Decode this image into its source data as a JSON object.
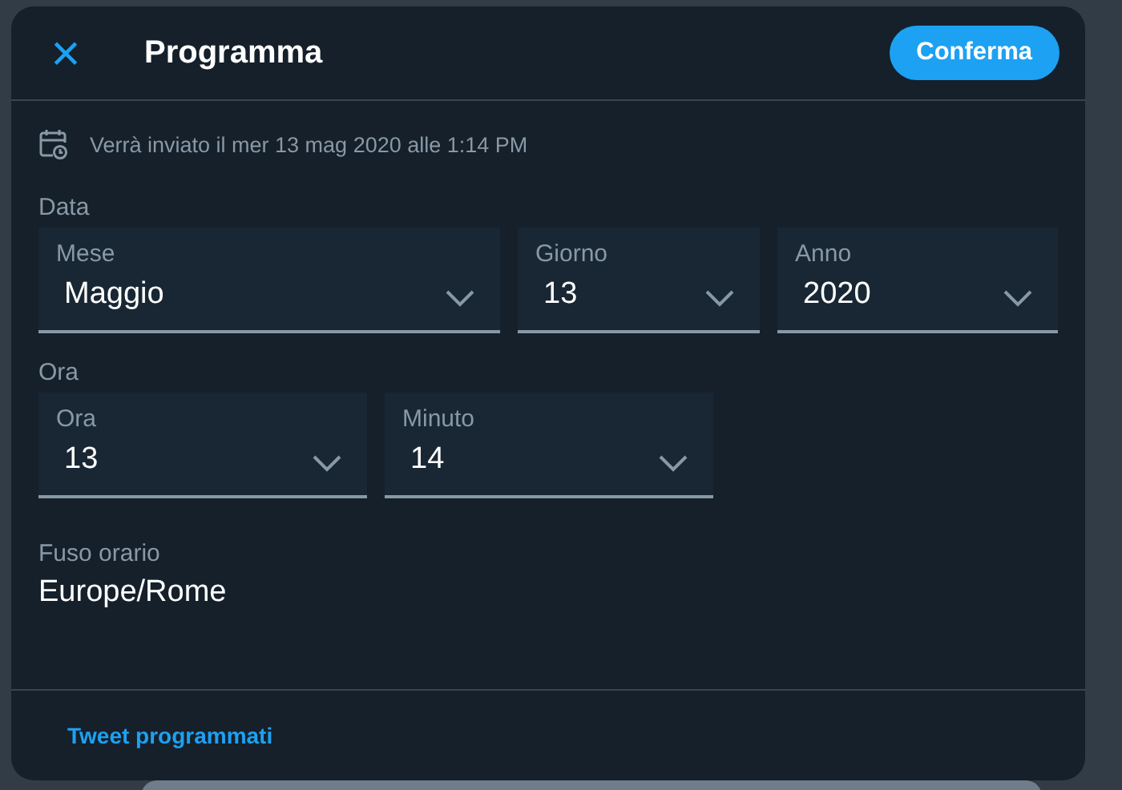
{
  "dialog": {
    "title": "Programma",
    "close_icon": "×",
    "confirm_button": "Conferma"
  },
  "notice": "Verrà inviato il mer 13 mag 2020 alle 1:14 PM",
  "sections": [
    {
      "label": "Data",
      "fields": [
        {
          "label": "Mese",
          "value": "Maggio",
          "kind": "select"
        },
        {
          "label": "Giorno",
          "value": "13",
          "kind": "select"
        },
        {
          "label": "Anno",
          "value": "2020",
          "kind": "select"
        }
      ]
    },
    {
      "label": "Ora",
      "fields": [
        {
          "label": "Ora",
          "value": "13",
          "kind": "select"
        },
        {
          "label": "Minuto",
          "value": "14",
          "kind": "select"
        }
      ]
    }
  ],
  "timezone": {
    "label": "Fuso orario",
    "value": "Europe/Rome"
  },
  "footer_link": "Tweet programmati"
}
